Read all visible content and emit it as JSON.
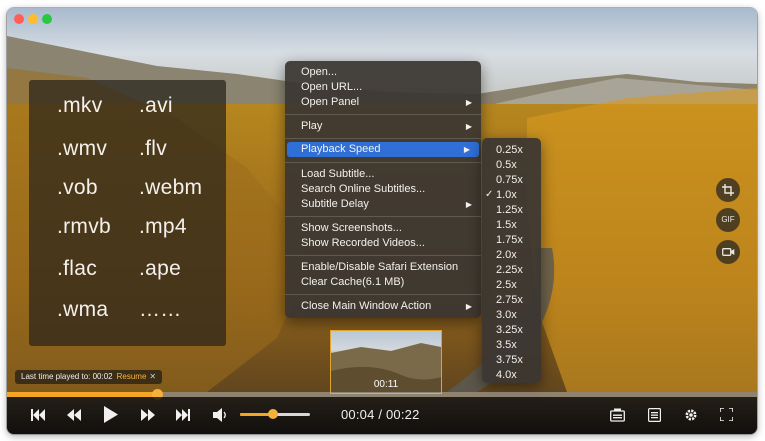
{
  "window": {
    "controls": {
      "close": "close-button",
      "minimize": "minimize-button",
      "maximize": "zoom-button"
    }
  },
  "formats": [
    ".mkv",
    ".avi",
    ".wmv",
    ".flv",
    ".vob",
    ".webm",
    ".rmvb",
    ".mp4",
    ".flac",
    ".ape",
    ".wma",
    "……"
  ],
  "context_menu": {
    "open": "Open...",
    "open_url": "Open URL...",
    "open_panel": "Open Panel",
    "play": "Play",
    "playback_speed": "Playback Speed",
    "load_subtitle": "Load Subtitle...",
    "search_subtitles": "Search Online Subtitles...",
    "subtitle_delay": "Subtitle Delay",
    "show_screenshots": "Show Screenshots...",
    "show_recorded": "Show Recorded Videos...",
    "safari_ext": "Enable/Disable Safari Extension",
    "clear_cache": "Clear Cache(6.1 MB)",
    "close_action": "Close Main Window Action",
    "submenu_arrow": "▶"
  },
  "speed_menu": {
    "options": [
      "0.25x",
      "0.5x",
      "0.75x",
      "1.0x",
      "1.25x",
      "1.5x",
      "1.75x",
      "2.0x",
      "2.25x",
      "2.5x",
      "2.75x",
      "3.0x",
      "3.25x",
      "3.5x",
      "3.75x",
      "4.0x"
    ],
    "selected": "1.0x",
    "check": "✓"
  },
  "side_buttons": {
    "gif_label": "GIF",
    "icons": [
      "crop-screenshot-icon",
      "gif-icon",
      "video-record-icon"
    ]
  },
  "preview": {
    "time": "00:11"
  },
  "resume_bar": {
    "label": "Last time played to: 00:02",
    "resume": "Resume",
    "close": "✕"
  },
  "playback": {
    "progress_fraction": 0.2,
    "volume_fraction": 0.47,
    "time_text": "00:04 / 00:22"
  },
  "colors": {
    "accent": "#f2a623",
    "menu_selection": "#2f6fd6",
    "menu_bg": "#3a3632",
    "traffic_close": "#ff5f57",
    "traffic_min": "#febc2e",
    "traffic_max": "#28c840"
  },
  "icons": {
    "skip_back": "⏮",
    "rewind": "⏪",
    "play": "▶",
    "forward": "⏩",
    "skip_next": "⏭",
    "volume": "🔈",
    "screenshot": "screenshot-icon",
    "playlist": "playlist-icon",
    "settings": "gear-icon",
    "fullscreen": "fullscreen-icon"
  }
}
